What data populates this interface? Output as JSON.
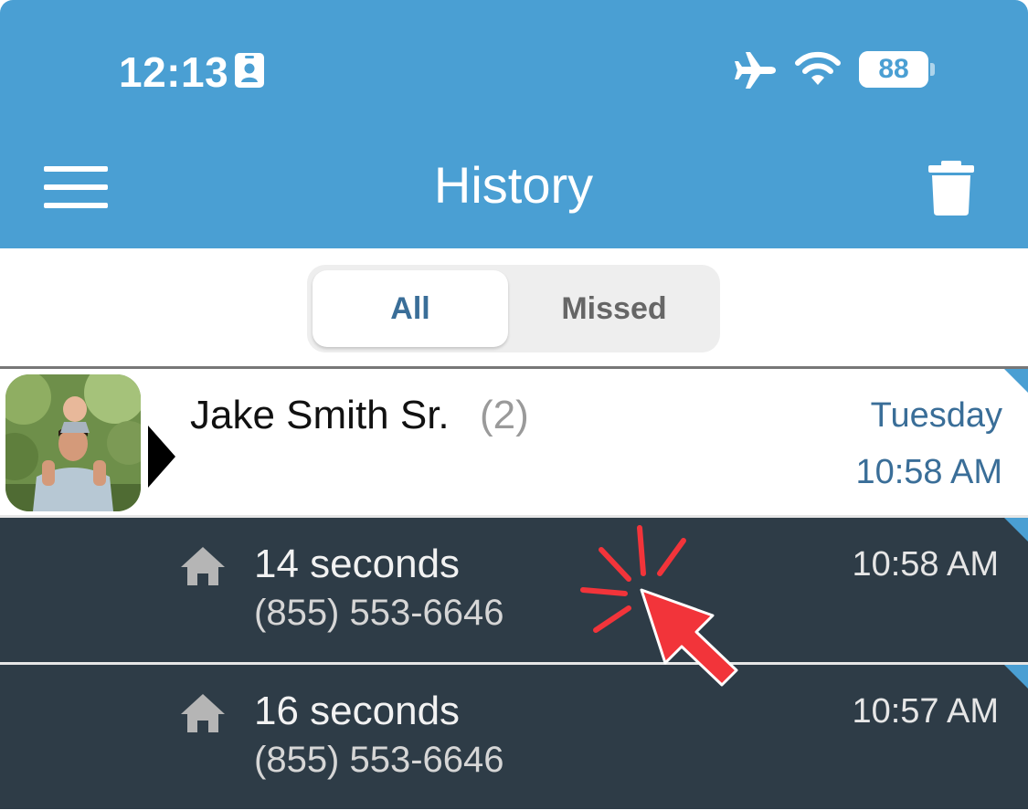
{
  "status_bar": {
    "time": "12:13",
    "battery_level": "88",
    "battery_fraction": 0.88,
    "icons": [
      "id-badge-icon",
      "airplane-icon",
      "wifi-icon",
      "battery-icon"
    ]
  },
  "header": {
    "title": "History",
    "menu_icon": "hamburger-menu-icon",
    "delete_icon": "trash-icon",
    "background_color": "#4a9fd3"
  },
  "filter": {
    "options": [
      "All",
      "Missed"
    ],
    "selected": "All"
  },
  "contact": {
    "name": "Jake Smith Sr.",
    "count": "(2)",
    "day": "Tuesday",
    "time": "10:58 AM",
    "accent_color": "#3a6e98"
  },
  "calls": [
    {
      "icon": "home-icon",
      "duration": "14 seconds",
      "number": "(855) 553-6646",
      "time": "10:58 AM"
    },
    {
      "icon": "home-icon",
      "duration": "16 seconds",
      "number": "(855) 553-6646",
      "time": "10:57 AM"
    }
  ],
  "overlay": {
    "tap_indicator_color": "#f2343a"
  }
}
